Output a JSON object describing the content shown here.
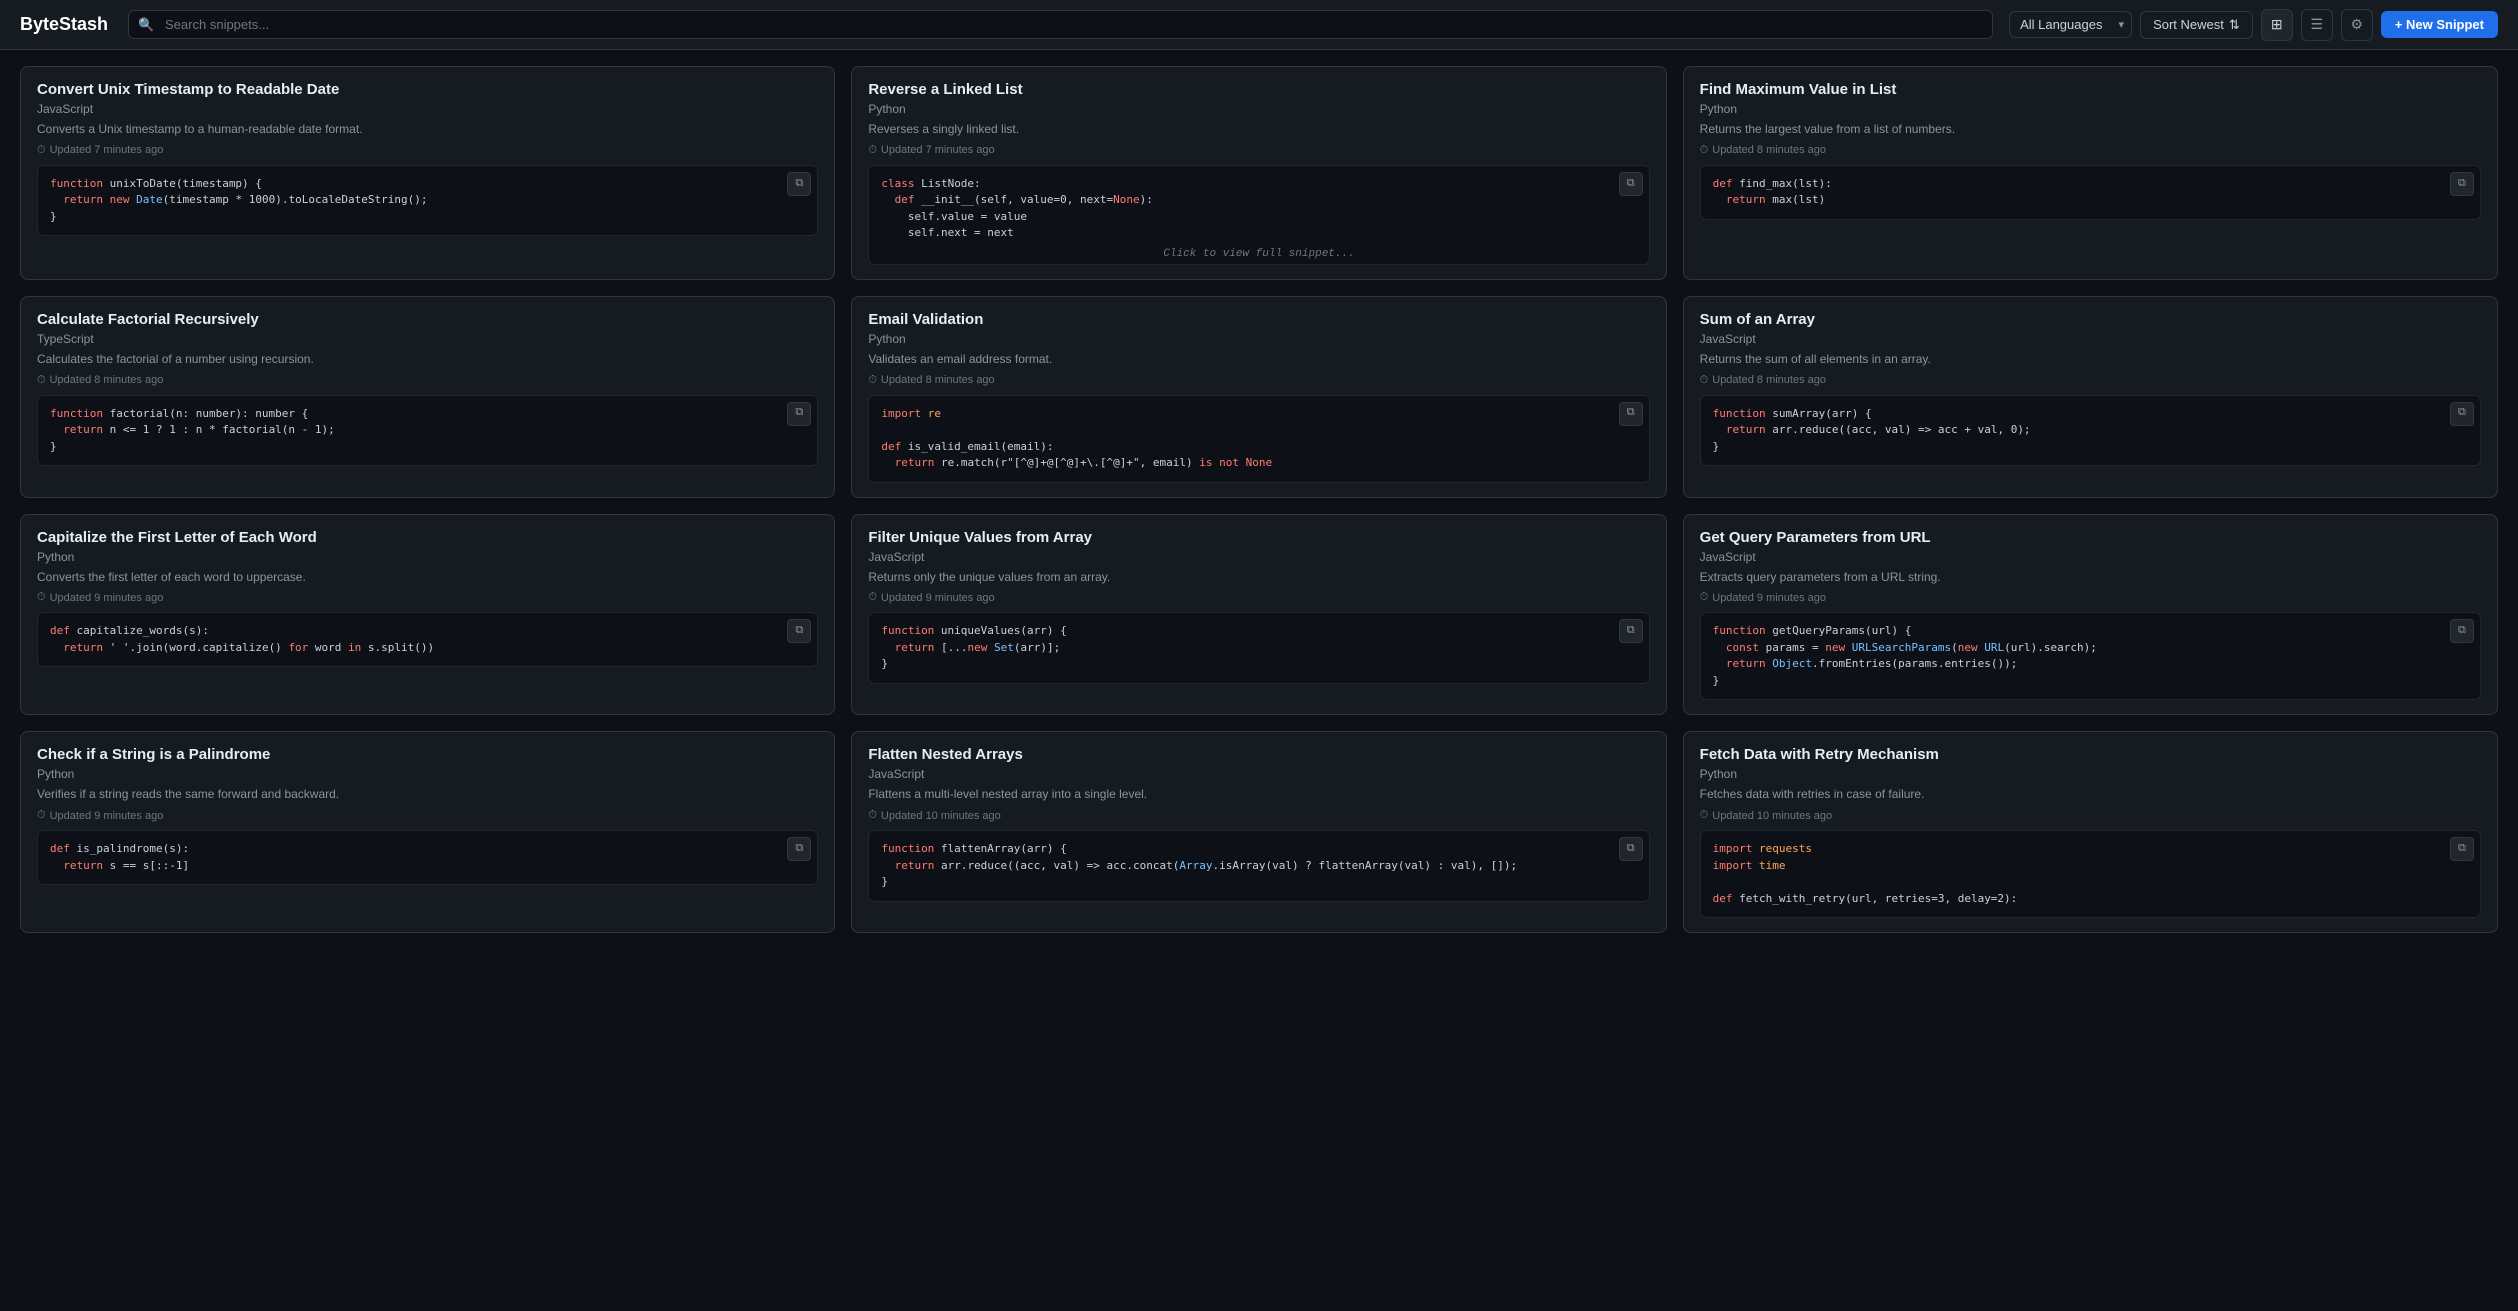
{
  "app": {
    "name": "ByteStash"
  },
  "header": {
    "search_placeholder": "Search snippets...",
    "lang_label": "All Languages",
    "sort_label": "Sort Newest",
    "new_snippet_label": "+ New Snippet"
  },
  "cards": [
    {
      "title": "Convert Unix Timestamp to Readable Date",
      "lang": "JavaScript",
      "desc": "Converts a Unix timestamp to a human-readable date format.",
      "updated": "Updated 7 minutes ago",
      "code_lines": [
        {
          "type": "keyword",
          "text": "function "
        },
        {
          "type": "func",
          "text": "unixToDate"
        },
        {
          "type": "plain",
          "text": "(timestamp) {"
        },
        {
          "type": "plain",
          "text": "  "
        },
        {
          "type": "keyword",
          "text": "return "
        },
        {
          "type": "keyword",
          "text": "new "
        },
        {
          "type": "func",
          "text": "Date"
        },
        {
          "type": "plain",
          "text": "(timestamp * 1000)."
        },
        {
          "type": "func",
          "text": "toLocaleDateString"
        },
        {
          "type": "plain",
          "text": "();"
        },
        {
          "type": "plain",
          "text": "}"
        }
      ],
      "code_raw": "function unixToDate(timestamp) {\n  return new Date(timestamp * 1000).toLocaleDateString();\n}"
    },
    {
      "title": "Reverse a Linked List",
      "lang": "Python",
      "desc": "Reverses a singly linked list.",
      "updated": "Updated 7 minutes ago",
      "code_raw": "class ListNode:\n  def __init__(self, value=0, next=None):\n    self.value = value\n    self.next = next",
      "has_hint": true,
      "hint": "Click to view full snippet..."
    },
    {
      "title": "Find Maximum Value in List",
      "lang": "Python",
      "desc": "Returns the largest value from a list of numbers.",
      "updated": "Updated 8 minutes ago",
      "code_raw": "def find_max(lst):\n  return max(lst)"
    },
    {
      "title": "Calculate Factorial Recursively",
      "lang": "TypeScript",
      "desc": "Calculates the factorial of a number using recursion.",
      "updated": "Updated 8 minutes ago",
      "code_raw": "function factorial(n: number): number {\n  return n <= 1 ? 1 : n * factorial(n - 1);\n}"
    },
    {
      "title": "Email Validation",
      "lang": "Python",
      "desc": "Validates an email address format.",
      "updated": "Updated 8 minutes ago",
      "code_raw": "import re\n\ndef is_valid_email(email):\n  return re.match(r\"[^@]+@[^@]+\\.[^@]+\", email) is not None"
    },
    {
      "title": "Sum of an Array",
      "lang": "JavaScript",
      "desc": "Returns the sum of all elements in an array.",
      "updated": "Updated 8 minutes ago",
      "code_raw": "function sumArray(arr) {\n  return arr.reduce((acc, val) => acc + val, 0);\n}"
    },
    {
      "title": "Capitalize the First Letter of Each Word",
      "lang": "Python",
      "desc": "Converts the first letter of each word to uppercase.",
      "updated": "Updated 9 minutes ago",
      "code_raw": "def capitalize_words(s):\n  return ' '.join(word.capitalize() for word in s.split())"
    },
    {
      "title": "Filter Unique Values from Array",
      "lang": "JavaScript",
      "desc": "Returns only the unique values from an array.",
      "updated": "Updated 9 minutes ago",
      "code_raw": "function uniqueValues(arr) {\n  return [...new Set(arr)];\n}"
    },
    {
      "title": "Get Query Parameters from URL",
      "lang": "JavaScript",
      "desc": "Extracts query parameters from a URL string.",
      "updated": "Updated 9 minutes ago",
      "code_raw": "function getQueryParams(url) {\n  const params = new URLSearchParams(new URL(url).search);\n  return Object.fromEntries(params.entries());\n}"
    },
    {
      "title": "Check if a String is a Palindrome",
      "lang": "Python",
      "desc": "Verifies if a string reads the same forward and backward.",
      "updated": "Updated 9 minutes ago",
      "code_raw": "def is_palindrome(s):\n  return s == s[::-1]"
    },
    {
      "title": "Flatten Nested Arrays",
      "lang": "JavaScript",
      "desc": "Flattens a multi-level nested array into a single level.",
      "updated": "Updated 10 minutes ago",
      "code_raw": "function flattenArray(arr) {\n  return arr.reduce((acc, val) => acc.concat(Array.isArray(val) ? flattenArray(val) : val), []);\n}"
    },
    {
      "title": "Fetch Data with Retry Mechanism",
      "lang": "Python",
      "desc": "Fetches data with retries in case of failure.",
      "updated": "Updated 10 minutes ago",
      "code_raw": "import requests\nimport time\n\ndef fetch_with_retry(url, retries=3, delay=2):"
    }
  ]
}
